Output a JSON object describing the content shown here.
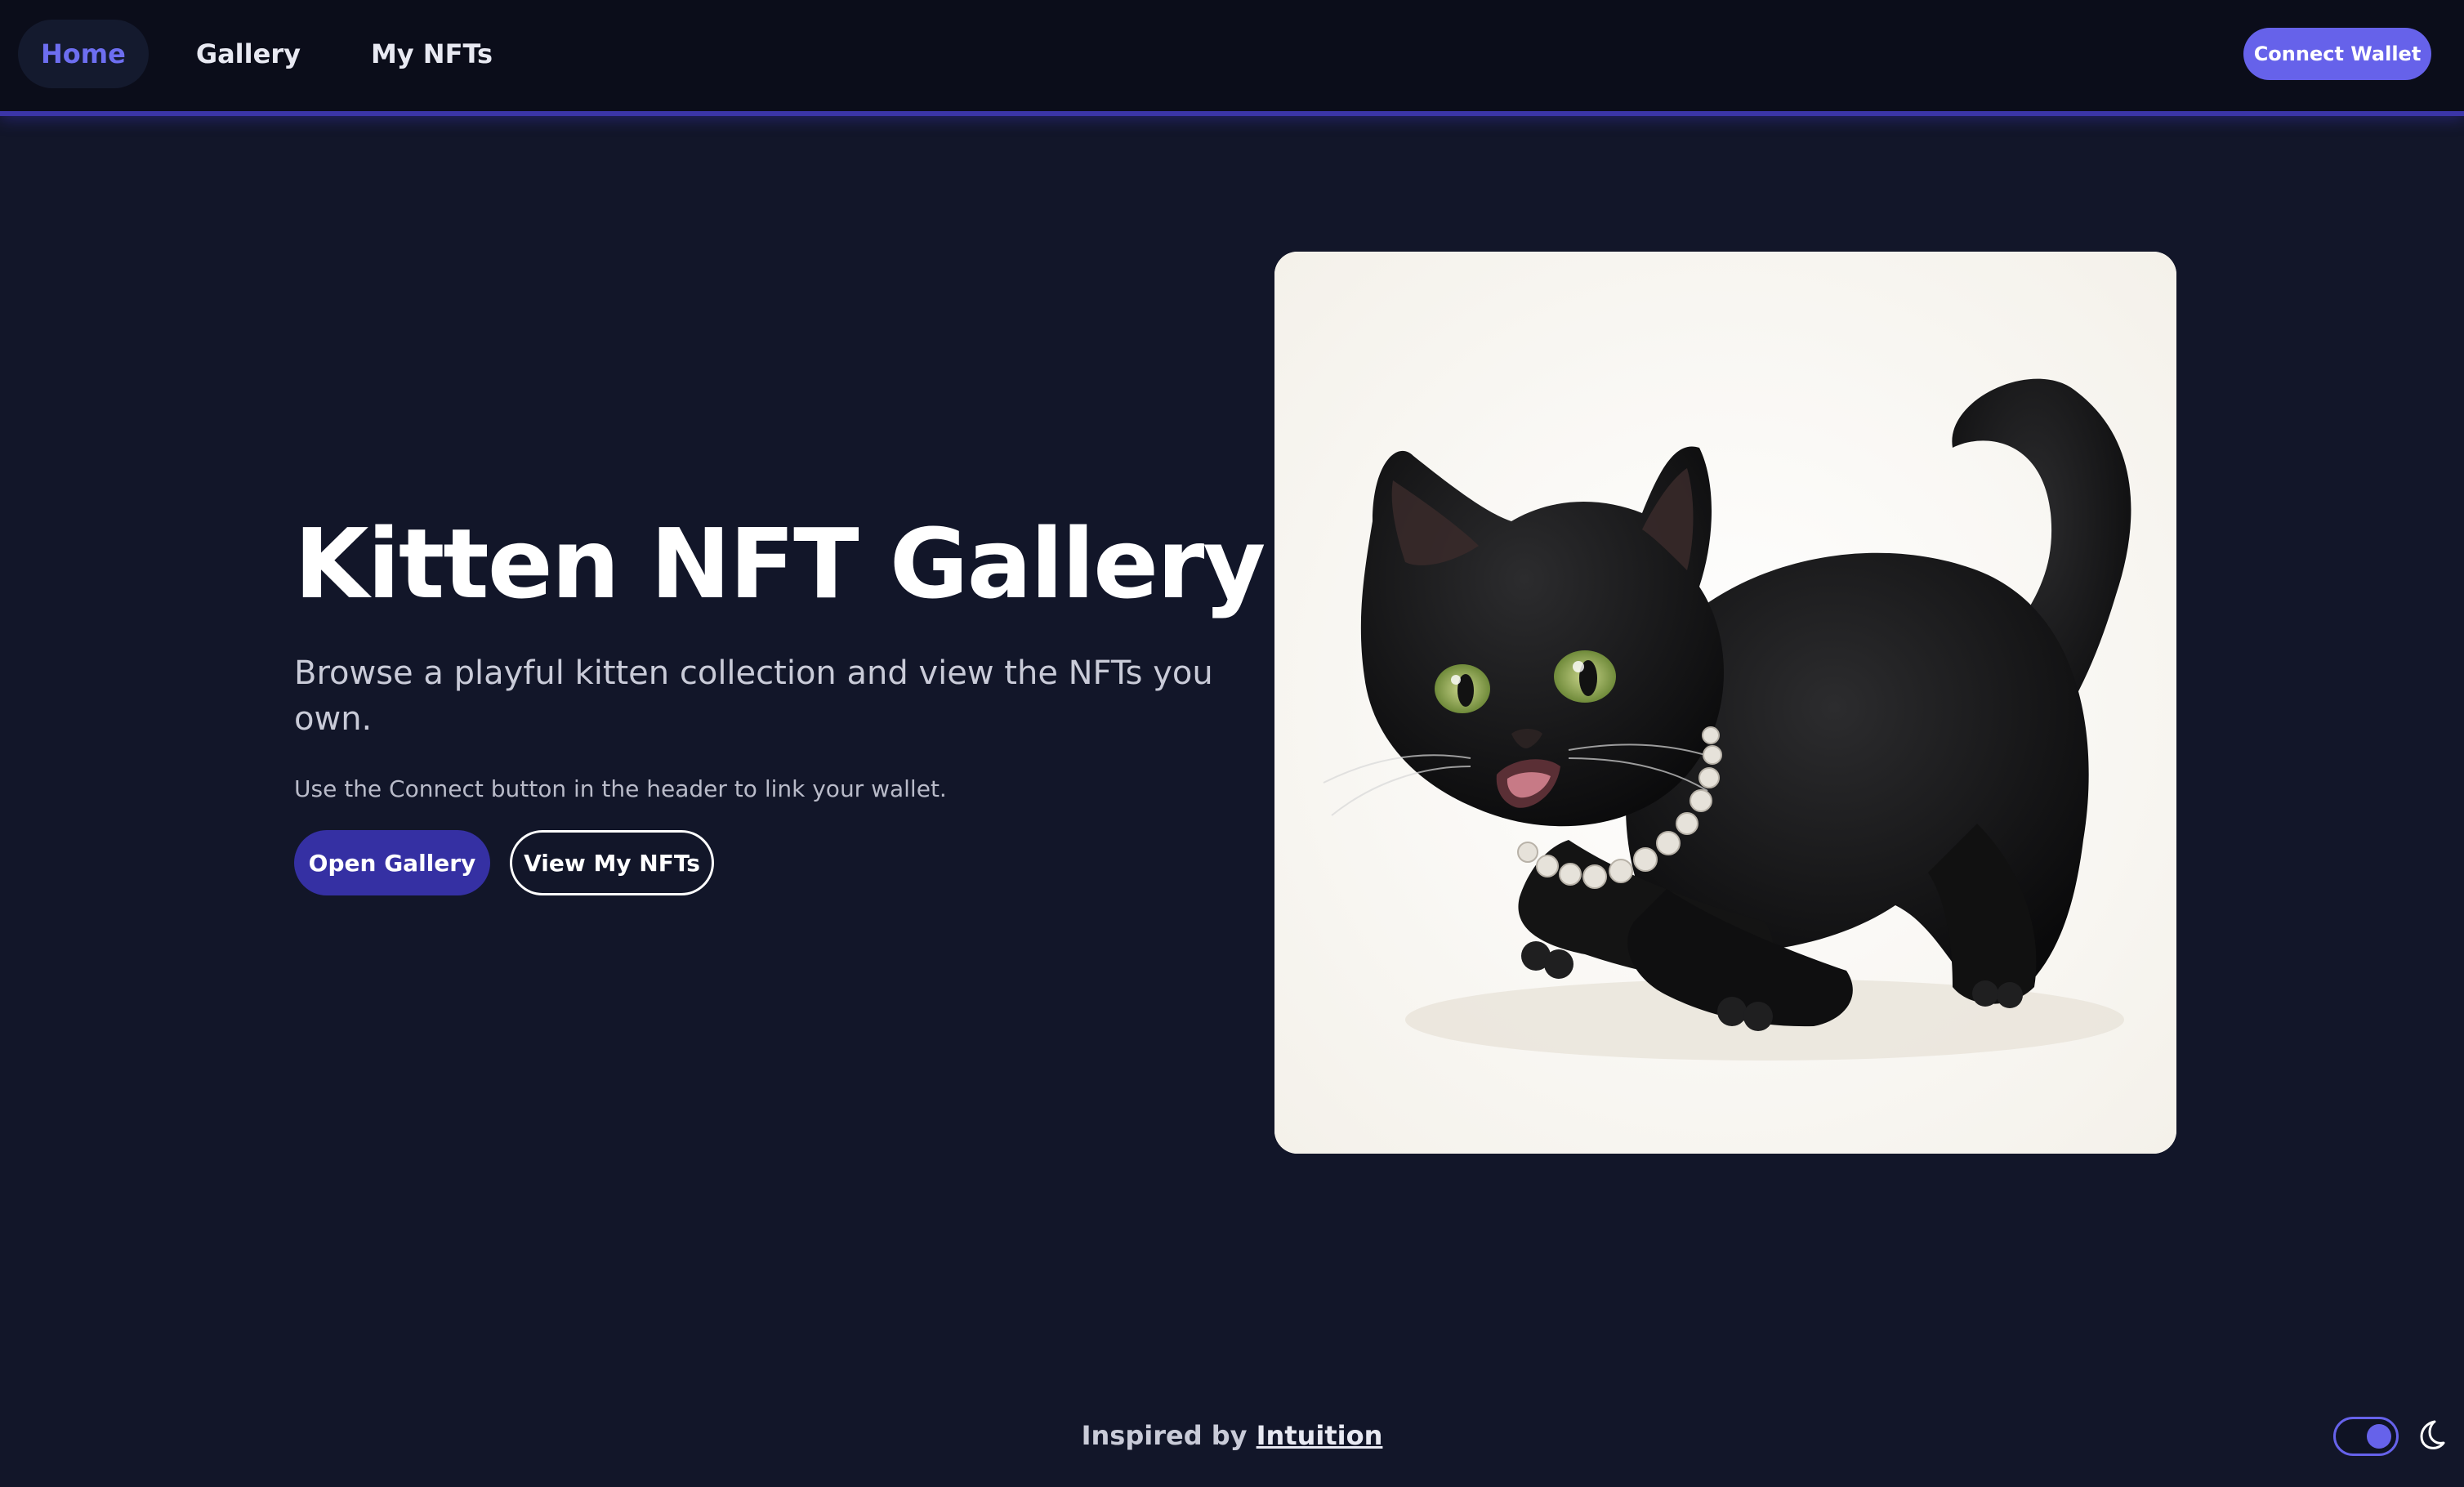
{
  "nav": {
    "items": [
      {
        "label": "Home",
        "active": true
      },
      {
        "label": "Gallery",
        "active": false
      },
      {
        "label": "My NFTs",
        "active": false
      }
    ],
    "connect_label": "Connect Wallet"
  },
  "hero": {
    "title": "Kitten NFT Gallery",
    "subtitle": "Browse a playful kitten collection and view the NFTs you own.",
    "note": "Use the Connect button in the header to link your wallet.",
    "primary_button": "Open Gallery",
    "secondary_button": "View My NFTs"
  },
  "footer": {
    "prefix": "Inspired by",
    "link": "Intuition"
  },
  "theme_toggle": {
    "mode": "dark",
    "icon": "moon-icon"
  },
  "colors": {
    "background": "#121629",
    "header": "#0b0d1a",
    "accent": "#6662ea",
    "primary_button": "#3530a3",
    "active_nav": "#6d6ef0"
  }
}
